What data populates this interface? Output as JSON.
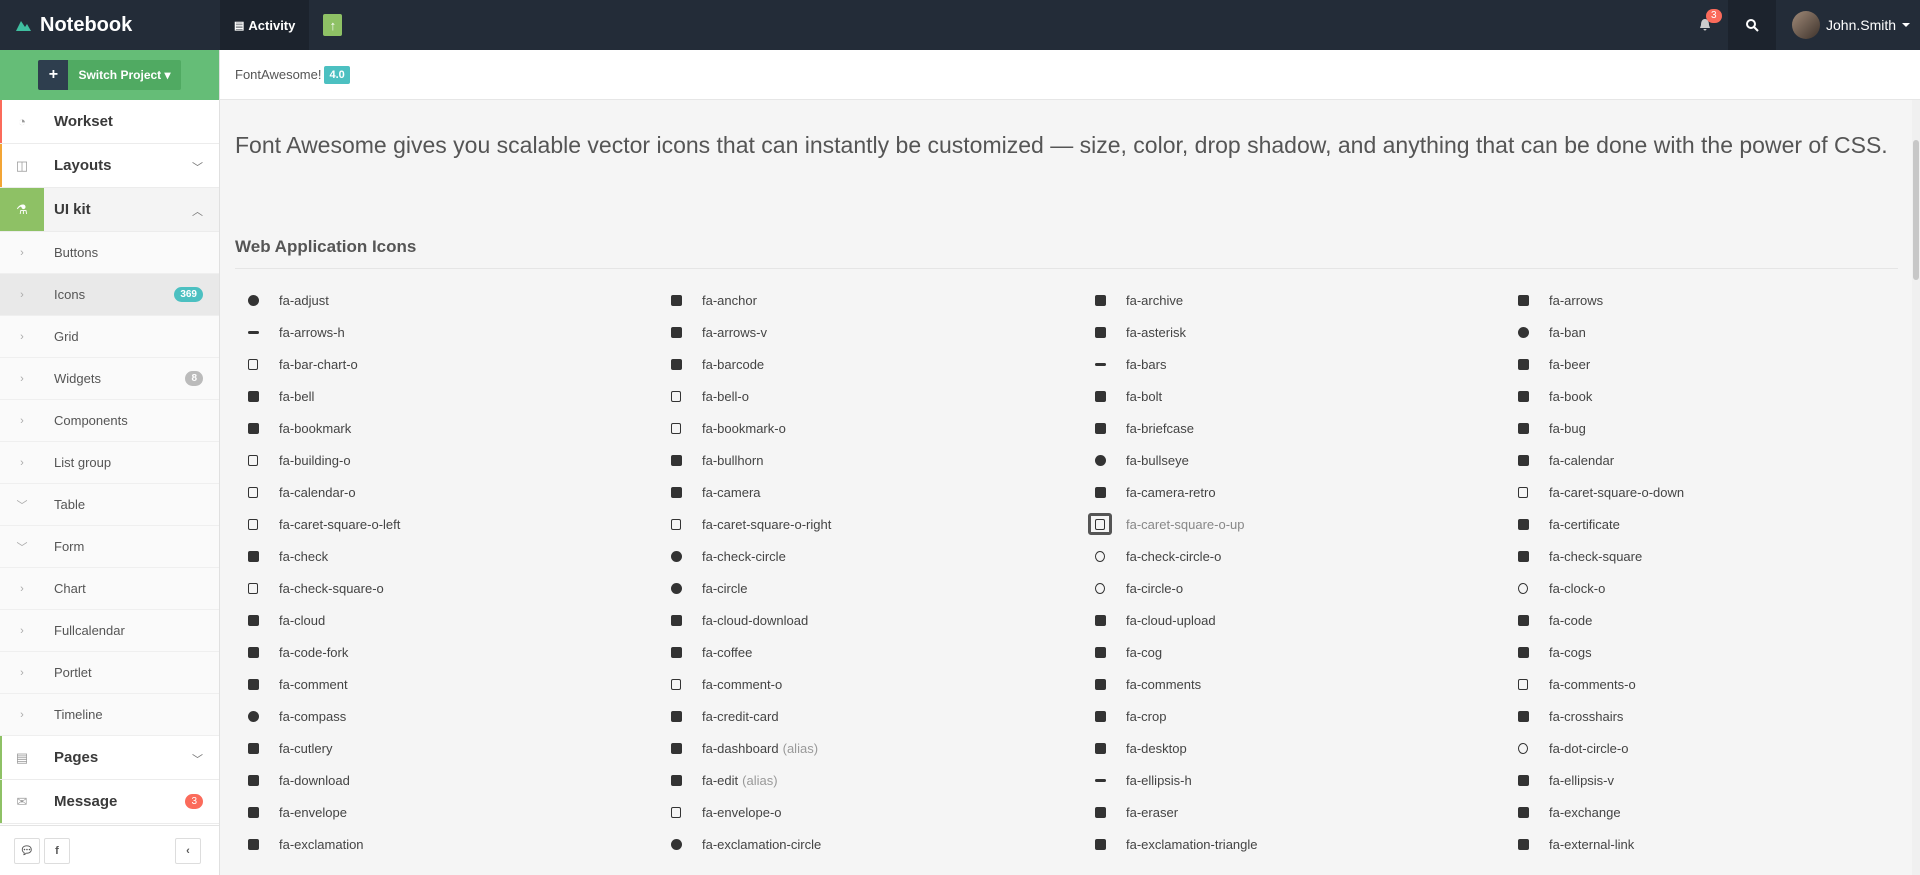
{
  "brand": {
    "name": "Notebook"
  },
  "topnav": {
    "activity": "Activity",
    "up_glyph": "↑",
    "notif_count": "3",
    "user_name": "John.Smith"
  },
  "sidebar": {
    "switch_label": "Switch Project",
    "items": [
      {
        "label": "Workset"
      },
      {
        "label": "Layouts"
      },
      {
        "label": "UI kit"
      },
      {
        "label": "Pages"
      },
      {
        "label": "Message",
        "badge": "3"
      }
    ],
    "sub": [
      {
        "label": "Buttons"
      },
      {
        "label": "Icons",
        "badge": "369"
      },
      {
        "label": "Grid"
      },
      {
        "label": "Widgets",
        "badge": "8"
      },
      {
        "label": "Components"
      },
      {
        "label": "List group"
      },
      {
        "label": "Table"
      },
      {
        "label": "Form"
      },
      {
        "label": "Chart"
      },
      {
        "label": "Fullcalendar"
      },
      {
        "label": "Portlet"
      },
      {
        "label": "Timeline"
      }
    ],
    "footer": {
      "fb": "f"
    }
  },
  "content": {
    "breadcrumb": "FontAwesome!",
    "version": "4.0",
    "lead": "Font Awesome gives you scalable vector icons that can instantly be customized — size, color, drop shadow, and anything that can be done with the power of CSS.",
    "section_title": "Web Application Icons",
    "icons": [
      {
        "n": "fa-adjust"
      },
      {
        "n": "fa-anchor"
      },
      {
        "n": "fa-archive"
      },
      {
        "n": "fa-arrows"
      },
      {
        "n": "fa-arrows-h"
      },
      {
        "n": "fa-arrows-v"
      },
      {
        "n": "fa-asterisk"
      },
      {
        "n": "fa-ban"
      },
      {
        "n": "fa-bar-chart-o"
      },
      {
        "n": "fa-barcode"
      },
      {
        "n": "fa-bars"
      },
      {
        "n": "fa-beer"
      },
      {
        "n": "fa-bell"
      },
      {
        "n": "fa-bell-o"
      },
      {
        "n": "fa-bolt"
      },
      {
        "n": "fa-book"
      },
      {
        "n": "fa-bookmark"
      },
      {
        "n": "fa-bookmark-o"
      },
      {
        "n": "fa-briefcase"
      },
      {
        "n": "fa-bug"
      },
      {
        "n": "fa-building-o"
      },
      {
        "n": "fa-bullhorn"
      },
      {
        "n": "fa-bullseye"
      },
      {
        "n": "fa-calendar"
      },
      {
        "n": "fa-calendar-o"
      },
      {
        "n": "fa-camera"
      },
      {
        "n": "fa-camera-retro"
      },
      {
        "n": "fa-caret-square-o-down"
      },
      {
        "n": "fa-caret-square-o-left"
      },
      {
        "n": "fa-caret-square-o-right"
      },
      {
        "n": "fa-caret-square-o-up",
        "hl": true
      },
      {
        "n": "fa-certificate"
      },
      {
        "n": "fa-check"
      },
      {
        "n": "fa-check-circle"
      },
      {
        "n": "fa-check-circle-o"
      },
      {
        "n": "fa-check-square"
      },
      {
        "n": "fa-check-square-o"
      },
      {
        "n": "fa-circle"
      },
      {
        "n": "fa-circle-o"
      },
      {
        "n": "fa-clock-o"
      },
      {
        "n": "fa-cloud"
      },
      {
        "n": "fa-cloud-download"
      },
      {
        "n": "fa-cloud-upload"
      },
      {
        "n": "fa-code"
      },
      {
        "n": "fa-code-fork"
      },
      {
        "n": "fa-coffee"
      },
      {
        "n": "fa-cog"
      },
      {
        "n": "fa-cogs"
      },
      {
        "n": "fa-comment"
      },
      {
        "n": "fa-comment-o"
      },
      {
        "n": "fa-comments"
      },
      {
        "n": "fa-comments-o"
      },
      {
        "n": "fa-compass"
      },
      {
        "n": "fa-credit-card"
      },
      {
        "n": "fa-crop"
      },
      {
        "n": "fa-crosshairs"
      },
      {
        "n": "fa-cutlery"
      },
      {
        "n": "fa-dashboard",
        "alias": "(alias)"
      },
      {
        "n": "fa-desktop"
      },
      {
        "n": "fa-dot-circle-o"
      },
      {
        "n": "fa-download"
      },
      {
        "n": "fa-edit",
        "alias": "(alias)"
      },
      {
        "n": "fa-ellipsis-h"
      },
      {
        "n": "fa-ellipsis-v"
      },
      {
        "n": "fa-envelope"
      },
      {
        "n": "fa-envelope-o"
      },
      {
        "n": "fa-eraser"
      },
      {
        "n": "fa-exchange"
      },
      {
        "n": "fa-exclamation"
      },
      {
        "n": "fa-exclamation-circle"
      },
      {
        "n": "fa-exclamation-triangle"
      },
      {
        "n": "fa-external-link"
      }
    ]
  },
  "colors": {
    "topbar": "#232c38",
    "accent_green": "#8ec165",
    "project_green": "#65bd77",
    "info": "#4cc0c1",
    "danger": "#fb6b5b"
  }
}
